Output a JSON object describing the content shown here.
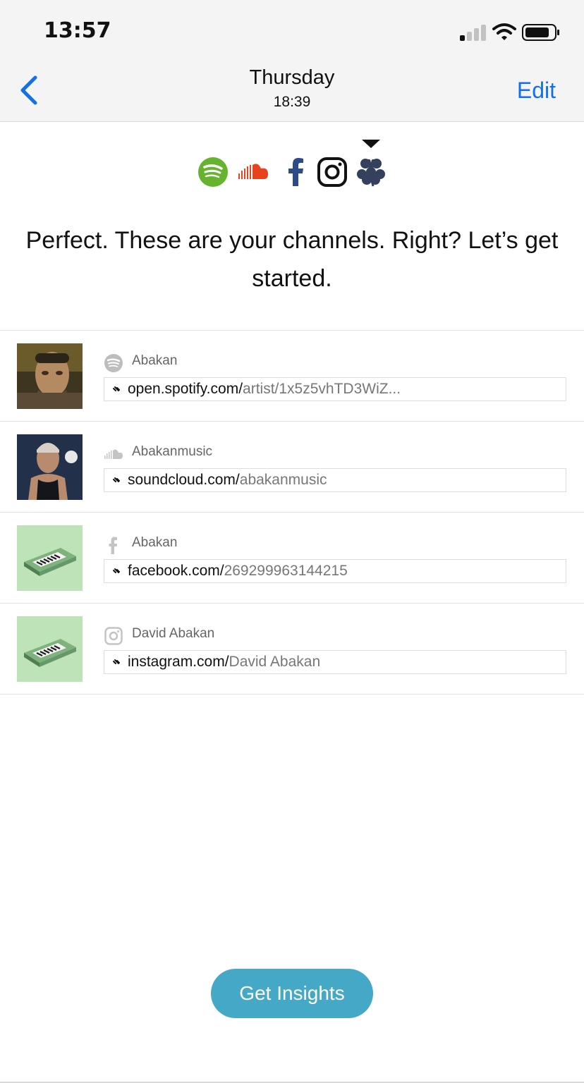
{
  "status_bar": {
    "time": "13:57"
  },
  "nav": {
    "title": "Thursday",
    "subtitle": "18:39",
    "edit_label": "Edit"
  },
  "channel_icons": [
    "spotify-icon",
    "soundcloud-icon",
    "facebook-icon",
    "instagram-icon",
    "clover-icon"
  ],
  "headline": "Perfect. These are your channels. Right? Let’s get started.",
  "channels": [
    {
      "source": "spotify-icon",
      "name": "Abakan",
      "url_base": "open.spotify.com/",
      "url_path": "artist/1x5z5vhTD3WiZ..."
    },
    {
      "source": "soundcloud-icon",
      "name": "Abakanmusic",
      "url_base": "soundcloud.com/",
      "url_path": "abakanmusic"
    },
    {
      "source": "facebook-icon",
      "name": "Abakan",
      "url_base": "facebook.com/",
      "url_path": "269299963144215"
    },
    {
      "source": "instagram-icon",
      "name": "David Abakan",
      "url_base": "instagram.com/",
      "url_path": "David Abakan"
    }
  ],
  "cta_label": "Get Insights",
  "colors": {
    "accent": "#1470e8",
    "button": "#44a8c6",
    "spotify": "#65b32e",
    "soundcloud": "#e8411b",
    "facebook": "#2d4a8a"
  }
}
